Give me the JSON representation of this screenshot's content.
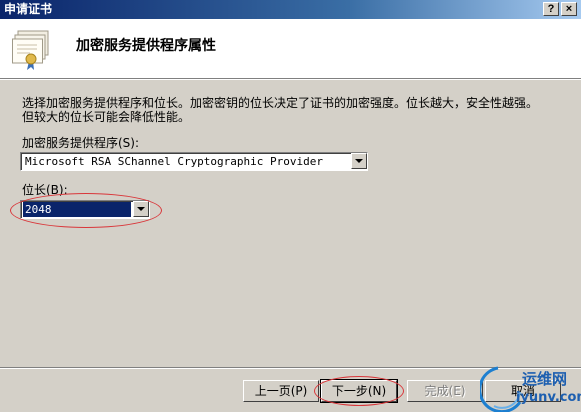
{
  "window": {
    "title": "申请证书",
    "help_button": "?",
    "close_button": "×"
  },
  "header": {
    "title": "加密服务提供程序属性",
    "icon": "certificate-icon"
  },
  "description": "选择加密服务提供程序和位长。加密密钥的位长决定了证书的加密强度。位长越大，安全性越强。但较大的位长可能会降低性能。",
  "csp": {
    "label": "加密服务提供程序(S):",
    "value": "Microsoft RSA SChannel Cryptographic Provider"
  },
  "bit_length": {
    "label": "位长(B):",
    "value": "2048"
  },
  "buttons": {
    "back": "上一页(P)",
    "next": "下一步(N)",
    "finish": "完成(E)",
    "cancel": "取消"
  },
  "watermark": {
    "line1": "运维网",
    "line2": "iyunv.com"
  },
  "colors": {
    "title_bar": "#0a246a",
    "face": "#d4d0c8",
    "highlight_ellipse": "#d9363a"
  }
}
